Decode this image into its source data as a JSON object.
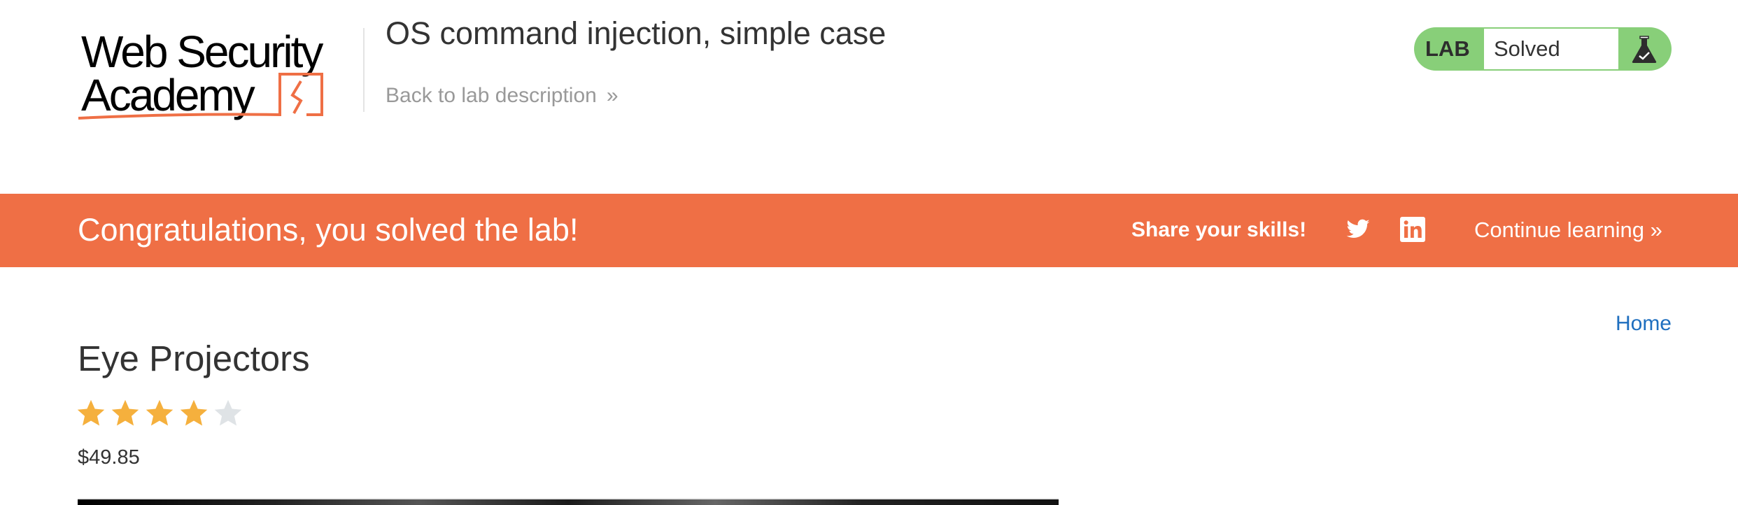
{
  "header": {
    "logo_text": "Web Security Academy",
    "lab_title": "OS command injection, simple case",
    "back_link": "Back to lab description",
    "back_chevron": "»",
    "lab_badge": {
      "label": "LAB",
      "status": "Solved",
      "icon": "flask-check-icon",
      "color": "#88cf79"
    }
  },
  "banner": {
    "message": "Congratulations, you solved the lab!",
    "share_label": "Share your skills!",
    "social": [
      "twitter-icon",
      "linkedin-icon"
    ],
    "continue_label": "Continue learning",
    "continue_chevron": "»",
    "color": "#ef6f45"
  },
  "nav": {
    "home": "Home"
  },
  "product": {
    "title": "Eye Projectors",
    "rating": 4,
    "rating_max": 5,
    "price": "$49.85"
  }
}
